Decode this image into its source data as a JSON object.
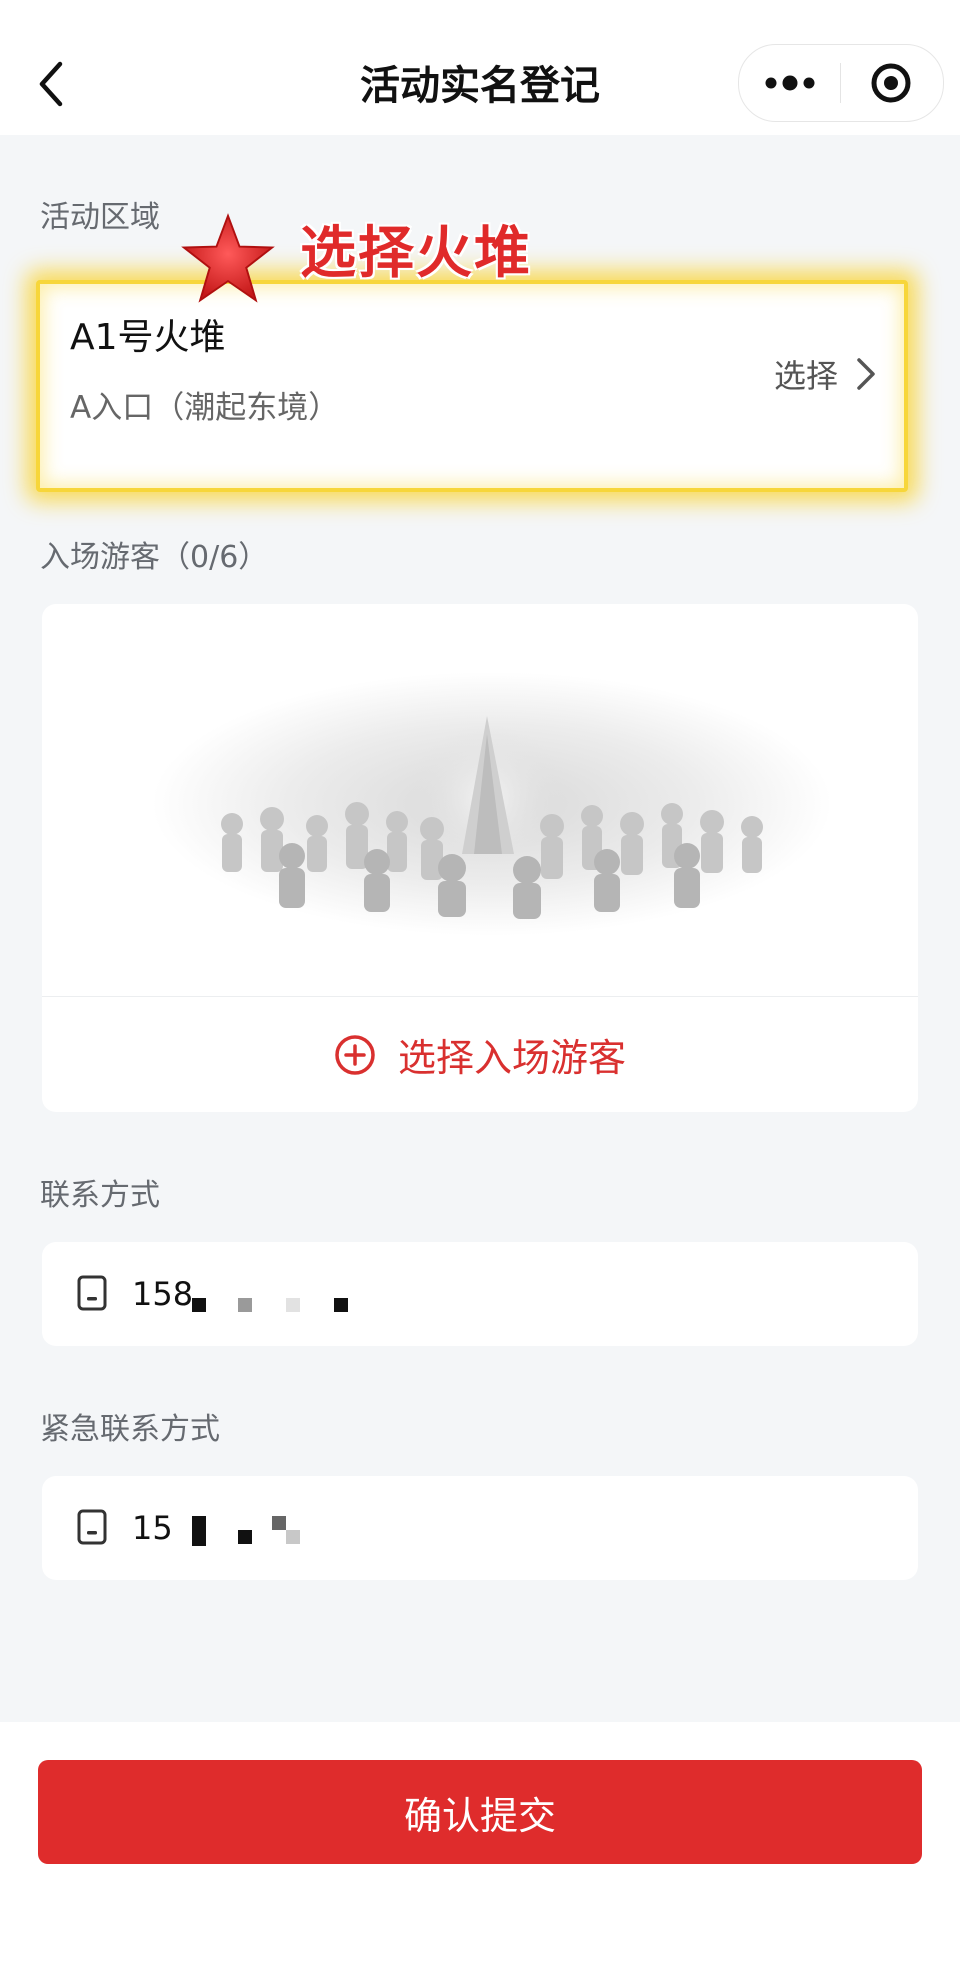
{
  "header": {
    "title": "活动实名登记"
  },
  "area": {
    "section_label": "活动区域",
    "annotation": "选择火堆",
    "name": "A1号火堆",
    "entrance": "A入口（潮起东境）",
    "select_label": "选择"
  },
  "visitors": {
    "section_label": "入场游客（0/6）",
    "add_label": "选择入场游客"
  },
  "contact": {
    "section_label": "联系方式",
    "phone_visible": "158"
  },
  "emergency": {
    "section_label": "紧急联系方式",
    "phone_visible": "15"
  },
  "submit": {
    "label": "确认提交"
  },
  "colors": {
    "accent": "#df2c2c",
    "highlight": "#f7d63a"
  }
}
